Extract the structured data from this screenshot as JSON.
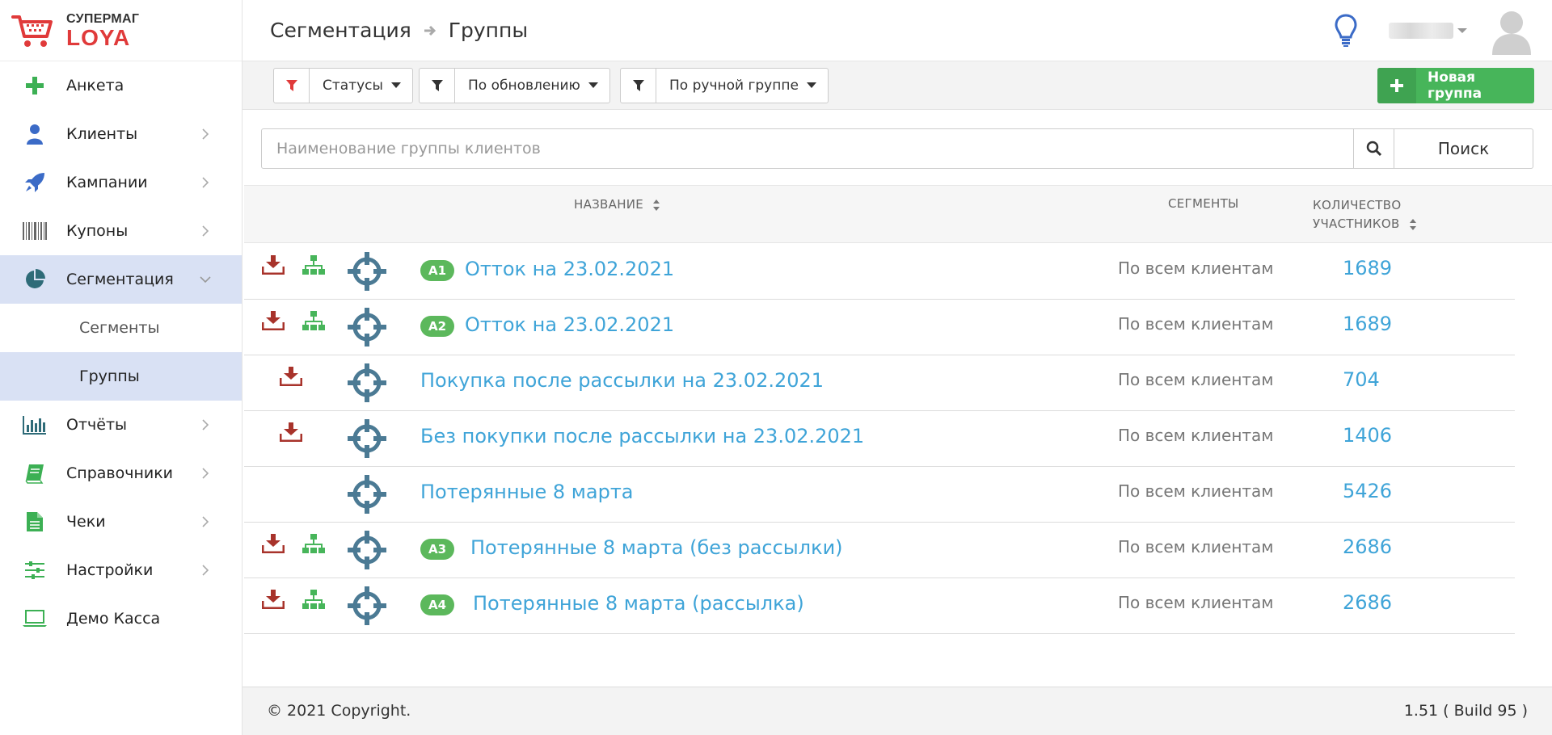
{
  "brand": {
    "line1": "СУПЕРМАГ",
    "line2": "LOYA"
  },
  "sidebar": {
    "items": [
      {
        "label": "Анкета",
        "icon": "plus-icon"
      },
      {
        "label": "Клиенты",
        "icon": "user-icon"
      },
      {
        "label": "Кампании",
        "icon": "rocket-icon"
      },
      {
        "label": "Купоны",
        "icon": "barcode-icon"
      },
      {
        "label": "Сегментация",
        "icon": "pie-chart-icon",
        "active": true
      },
      {
        "label": "Отчёты",
        "icon": "bar-chart-icon"
      },
      {
        "label": "Справочники",
        "icon": "book-icon"
      },
      {
        "label": "Чеки",
        "icon": "document-icon"
      },
      {
        "label": "Настройки",
        "icon": "sliders-icon"
      },
      {
        "label": "Демо Касса",
        "icon": "laptop-icon"
      }
    ],
    "subitems": [
      {
        "label": "Сегменты"
      },
      {
        "label": "Группы",
        "active": true
      }
    ]
  },
  "header": {
    "breadcrumb": [
      "Сегментация",
      "Группы"
    ]
  },
  "toolbar": {
    "filters": [
      "Статусы",
      "По обновлению",
      "По ручной группе"
    ],
    "new_group": "Новая группа"
  },
  "search": {
    "placeholder": "Наименование группы клиентов",
    "button": "Поиск"
  },
  "table": {
    "columns": {
      "name": "НАЗВАНИЕ",
      "segments": "СЕГМЕНТЫ",
      "count_line1": "КОЛИЧЕСТВО",
      "count_line2": "УЧАСТНИКОВ"
    },
    "rows": [
      {
        "badge": "A1",
        "name": "Отток на 23.02.2021",
        "segment": "По всем клиентам",
        "count": "1689",
        "download": true,
        "hierarchy": true
      },
      {
        "badge": "A2",
        "name": "Отток на 23.02.2021",
        "segment": "По всем клиентам",
        "count": "1689",
        "download": true,
        "hierarchy": true
      },
      {
        "badge": "",
        "name": "Покупка после рассылки на 23.02.2021",
        "segment": "По всем клиентам",
        "count": "704",
        "download": true,
        "hierarchy": false
      },
      {
        "badge": "",
        "name": "Без покупки после рассылки на 23.02.2021",
        "segment": "По всем клиентам",
        "count": "1406",
        "download": true,
        "hierarchy": false
      },
      {
        "badge": "",
        "name": "Потерянные 8 марта",
        "segment": "По всем клиентам",
        "count": "5426",
        "download": false,
        "hierarchy": false
      },
      {
        "badge": "A3",
        "name": "Потерянные 8 марта (без рассылки)",
        "segment": "По всем клиентам",
        "count": "2686",
        "download": true,
        "hierarchy": true
      },
      {
        "badge": "A4",
        "name": "Потерянные 8 марта (рассылка)",
        "segment": "По всем клиентам",
        "count": "2686",
        "download": true,
        "hierarchy": true
      }
    ]
  },
  "footer": {
    "copyright": "© 2021 Copyright.",
    "version": "1.51 ( Build 95 )"
  },
  "colors": {
    "accent": "#3fa4d8",
    "green": "#47b55a",
    "red": "#a8332b",
    "active_bg": "#d9e1f4",
    "target": "#4b7a94"
  }
}
